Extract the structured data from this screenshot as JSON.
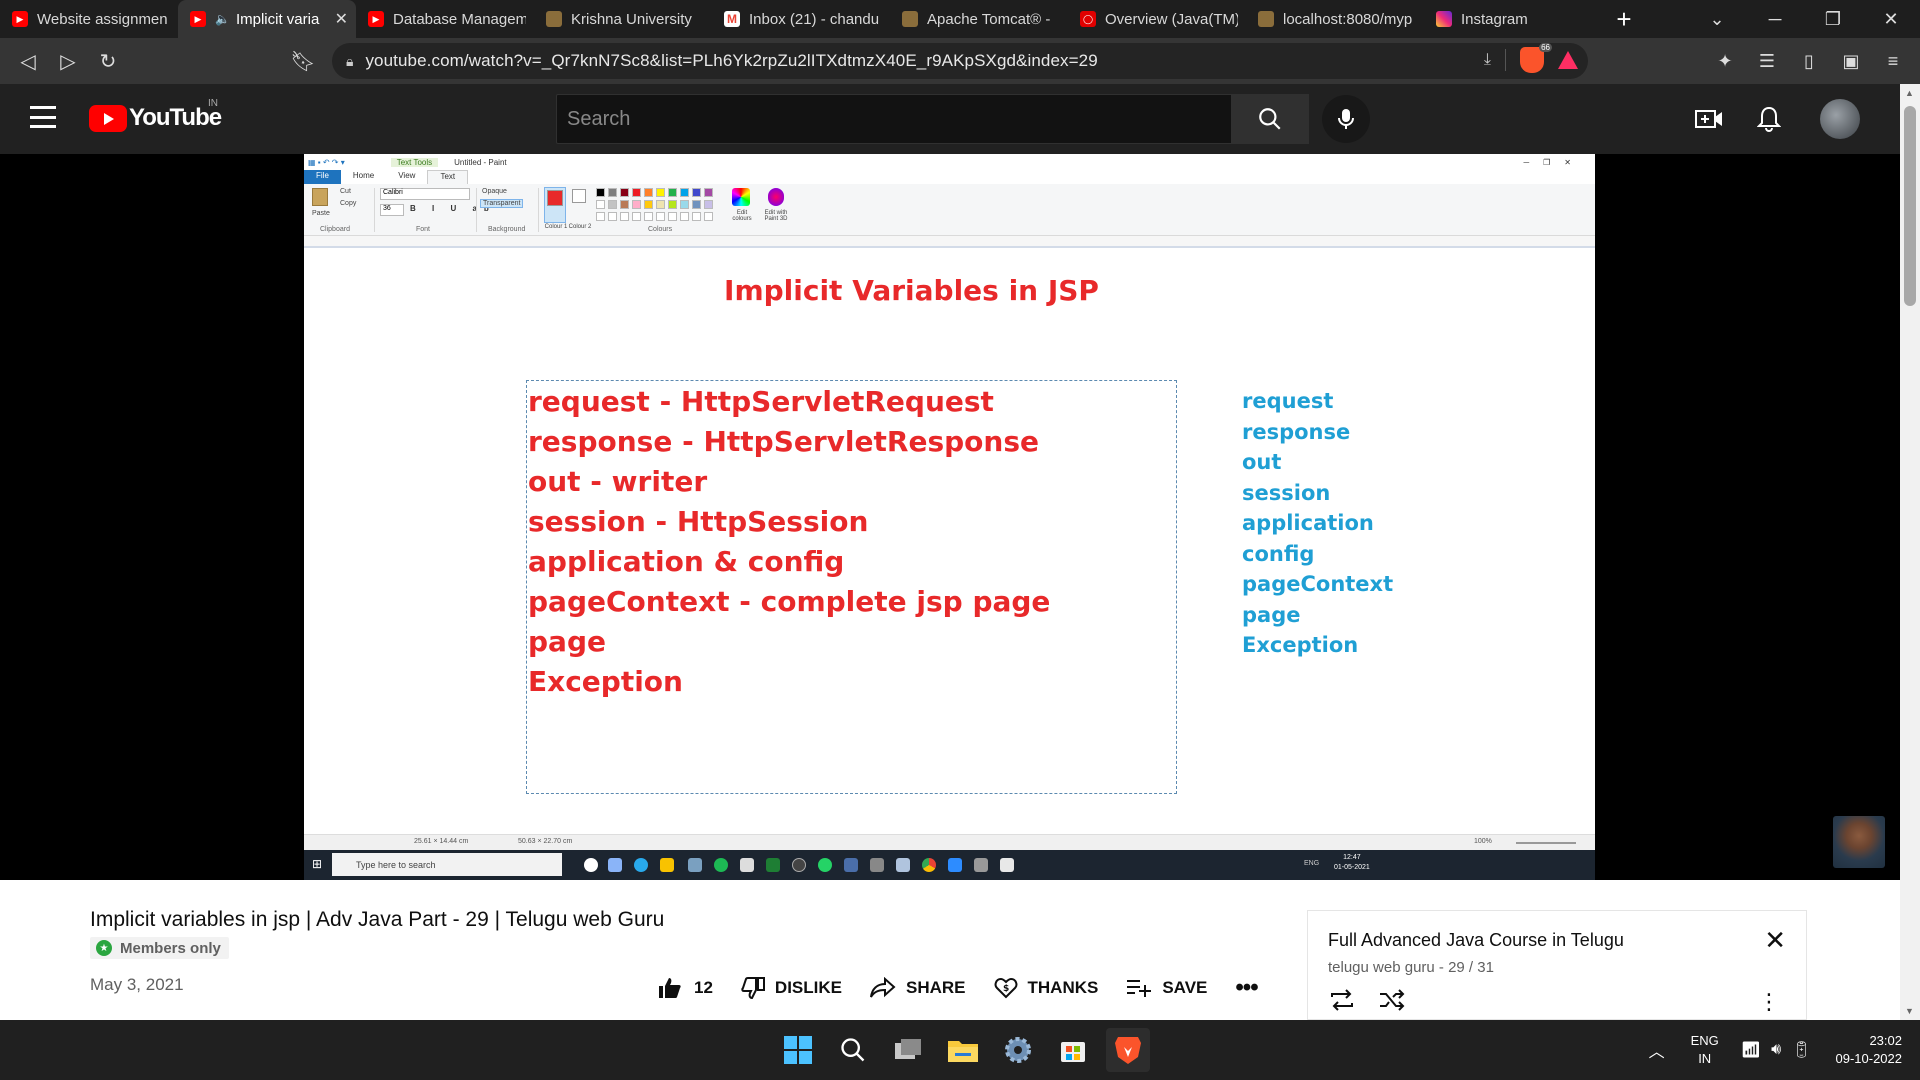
{
  "tabs": [
    {
      "label": "Website assignmen",
      "fav_color": "#ff0000",
      "active": false
    },
    {
      "label": "Implicit varia",
      "fav_color": "#ff0000",
      "active": true
    },
    {
      "label": "Database Managem",
      "fav_color": "#ff0000",
      "active": false
    },
    {
      "label": "Krishna University",
      "fav_color": "#8a6d3b",
      "active": false
    },
    {
      "label": "Inbox (21) - chandu",
      "fav_color": "#ea4335",
      "active": false
    },
    {
      "label": "Apache Tomcat® -",
      "fav_color": "#8a6d3b",
      "active": false
    },
    {
      "label": "Overview (Java(TM)",
      "fav_color": "#e00000",
      "active": false
    },
    {
      "label": "localhost:8080/myp",
      "fav_color": "#8a6d3b",
      "active": false
    },
    {
      "label": "Instagram",
      "fav_color": "#d6249f",
      "active": false
    }
  ],
  "address": {
    "url": "youtube.com/watch?v=_Qr7knN7Sc8&list=PLh6Yk2rpZu2lITXdtmzX40E_r9AKpSXgd&index=29",
    "brave_count": "66"
  },
  "youtube": {
    "logo_text": "YouTube",
    "country": "IN",
    "search_placeholder": "Search"
  },
  "paint": {
    "window_title": "Untitled - Paint",
    "context_tab": "Text Tools",
    "tabs": [
      "File",
      "Home",
      "View",
      "Text"
    ],
    "font_name": "Calibri",
    "font_size": "36",
    "groups": [
      "Clipboard",
      "Font",
      "Background",
      "Colours"
    ],
    "paste": "Paste",
    "cut": "Cut",
    "copy": "Copy",
    "opaque": "Opaque",
    "transparent": "Transparent",
    "colour1": "Colour 1",
    "colour2": "Colour 2",
    "edit_colours": "Edit colours",
    "edit_paint3d": "Edit with Paint 3D",
    "status_size": "25.61 × 14.44 cm",
    "status_sel": "50.63 × 22.70 cm",
    "zoom": "100%",
    "taskbar_search": "Type here to search",
    "taskbar_time": "12:47",
    "taskbar_date": "01-05-2021",
    "taskbar_lang": "ENG"
  },
  "slide": {
    "title": "Implicit Variables in JSP",
    "red_lines": [
      "request - HttpServletRequest",
      "response - HttpServletResponse",
      "out - writer",
      "session - HttpSession",
      "application & config",
      "pageContext - complete jsp page",
      "page",
      "Exception"
    ],
    "blue_lines": [
      "request",
      "response",
      "out",
      "session",
      "application",
      "config",
      "pageContext",
      "page",
      "Exception"
    ],
    "red_color": "#e8292a",
    "blue_color": "#1f9fd4"
  },
  "video_info": {
    "title": "Implicit variables in jsp | Adv Java Part - 29 | Telugu web Guru",
    "badge": "Members only",
    "date": "May 3, 2021",
    "likes": "12",
    "dislike": "DISLIKE",
    "share": "SHARE",
    "thanks": "THANKS",
    "save": "SAVE"
  },
  "playlist": {
    "title": "Full Advanced Java Course in Telugu",
    "channel_position": "telugu web guru - 29 / 31"
  },
  "taskbar": {
    "lang1": "ENG",
    "lang2": "IN",
    "time": "23:02",
    "date": "09-10-2022"
  }
}
